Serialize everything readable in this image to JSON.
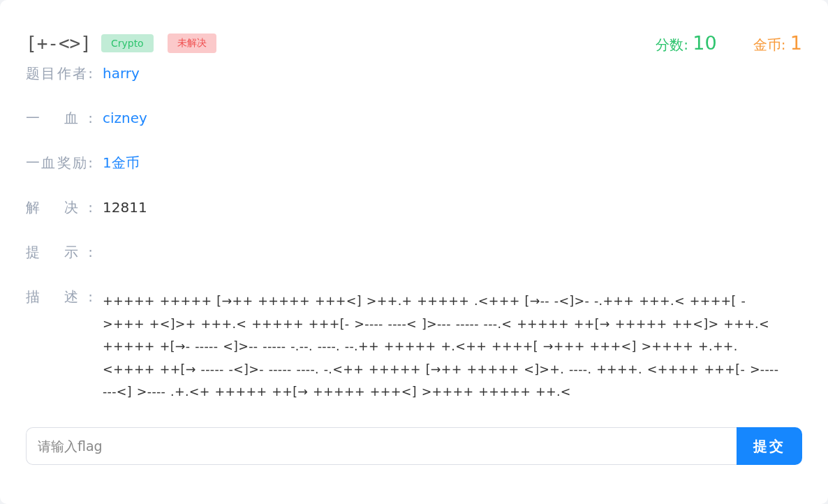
{
  "challenge": {
    "title": "[+-<>]",
    "category": "Crypto",
    "status": {
      "label": "未解决",
      "solved": false
    },
    "score": {
      "label": "分数:",
      "value": "10"
    },
    "coins": {
      "label": "金币:",
      "value": "1"
    },
    "fields": [
      {
        "label": "题目作者:",
        "value": "harry",
        "kind": "link"
      },
      {
        "label": "一 血:",
        "value": "cizney",
        "kind": "link"
      },
      {
        "label": "一血奖励:",
        "value": "1金币",
        "kind": "link"
      },
      {
        "label": "解 决:",
        "value": "12811",
        "kind": "text"
      },
      {
        "label": "提 示:",
        "kind": "empty"
      },
      {
        "label": "描 述:",
        "value": "+++++ +++++ [→++ +++++ +++<] >++.+ +++++ .<+++ [→-- -<]>- -.+++ +++.< ++++[ - >+++ +<]>+ +++.< +++++ +++[- >---- ----< ]>--- ----- ---.< +++++ ++[→ +++++ ++<]> +++.< +++++ +[→- ----- <]>-- ----- -.--. ----. --.++ +++++ +.<++ ++++[ →+++ +++<] >++++ +.++. <++++ ++[→ ----- -<]>- ----- ----. -.<++ +++++ [→++ +++++ <]>+. ----. ++++. <++++ +++[- >---- ---<] >---- .+.<+ +++++ ++[→ +++++ +++<] >++++ +++++ ++.<",
        "kind": "code"
      }
    ],
    "flag": {
      "placeholder": "请输入flag",
      "button": "提交"
    }
  }
}
